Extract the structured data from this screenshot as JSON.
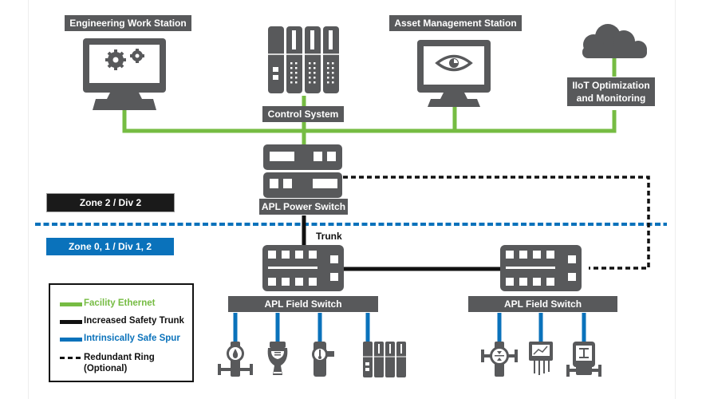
{
  "colors": {
    "device": "#58595b",
    "ethernet": "#76bc43",
    "trunk": "#111111",
    "spur": "#0a72bb",
    "zone2_bg": "#1a1a1a",
    "zone01_bg": "#0a72bb"
  },
  "nodes": {
    "engineering": {
      "label": "Engineering Work Station",
      "icon": "monitor-gears-icon"
    },
    "control": {
      "label": "Control System",
      "icon": "controller-rack-icon"
    },
    "asset": {
      "label": "Asset Management Station",
      "icon": "monitor-eye-icon"
    },
    "iiot": {
      "label_line1": "IIoT Optimization",
      "label_line2": "and Monitoring",
      "icon": "cloud-icon"
    },
    "power_switch": {
      "label": "APL Power Switch",
      "icon": "power-switch-icon"
    },
    "field_switch_1": {
      "label": "APL Field Switch",
      "icon": "field-switch-icon"
    },
    "field_switch_2": {
      "label": "APL Field Switch",
      "icon": "field-switch-icon"
    }
  },
  "trunk_label": "Trunk",
  "zones": {
    "zone2": "Zone 2 / Div 2",
    "zone01": "Zone 0, 1 / Div 1, 2"
  },
  "field_devices_1": [
    "flow-meter-icon",
    "level-transmitter-icon",
    "temperature-transmitter-icon",
    "remote-io-rack-icon"
  ],
  "field_devices_2": [
    "pressure-transmitter-icon",
    "analyzer-icon",
    "valve-actuator-icon"
  ],
  "legend": [
    {
      "label": "Facility Ethernet",
      "style": "ethernet"
    },
    {
      "label": "Increased Safety Trunk",
      "style": "trunk"
    },
    {
      "label": "Intrinsically Safe Spur",
      "style": "spur"
    },
    {
      "label": "Redundant Ring",
      "label2": "(Optional)",
      "style": "dashed"
    }
  ]
}
